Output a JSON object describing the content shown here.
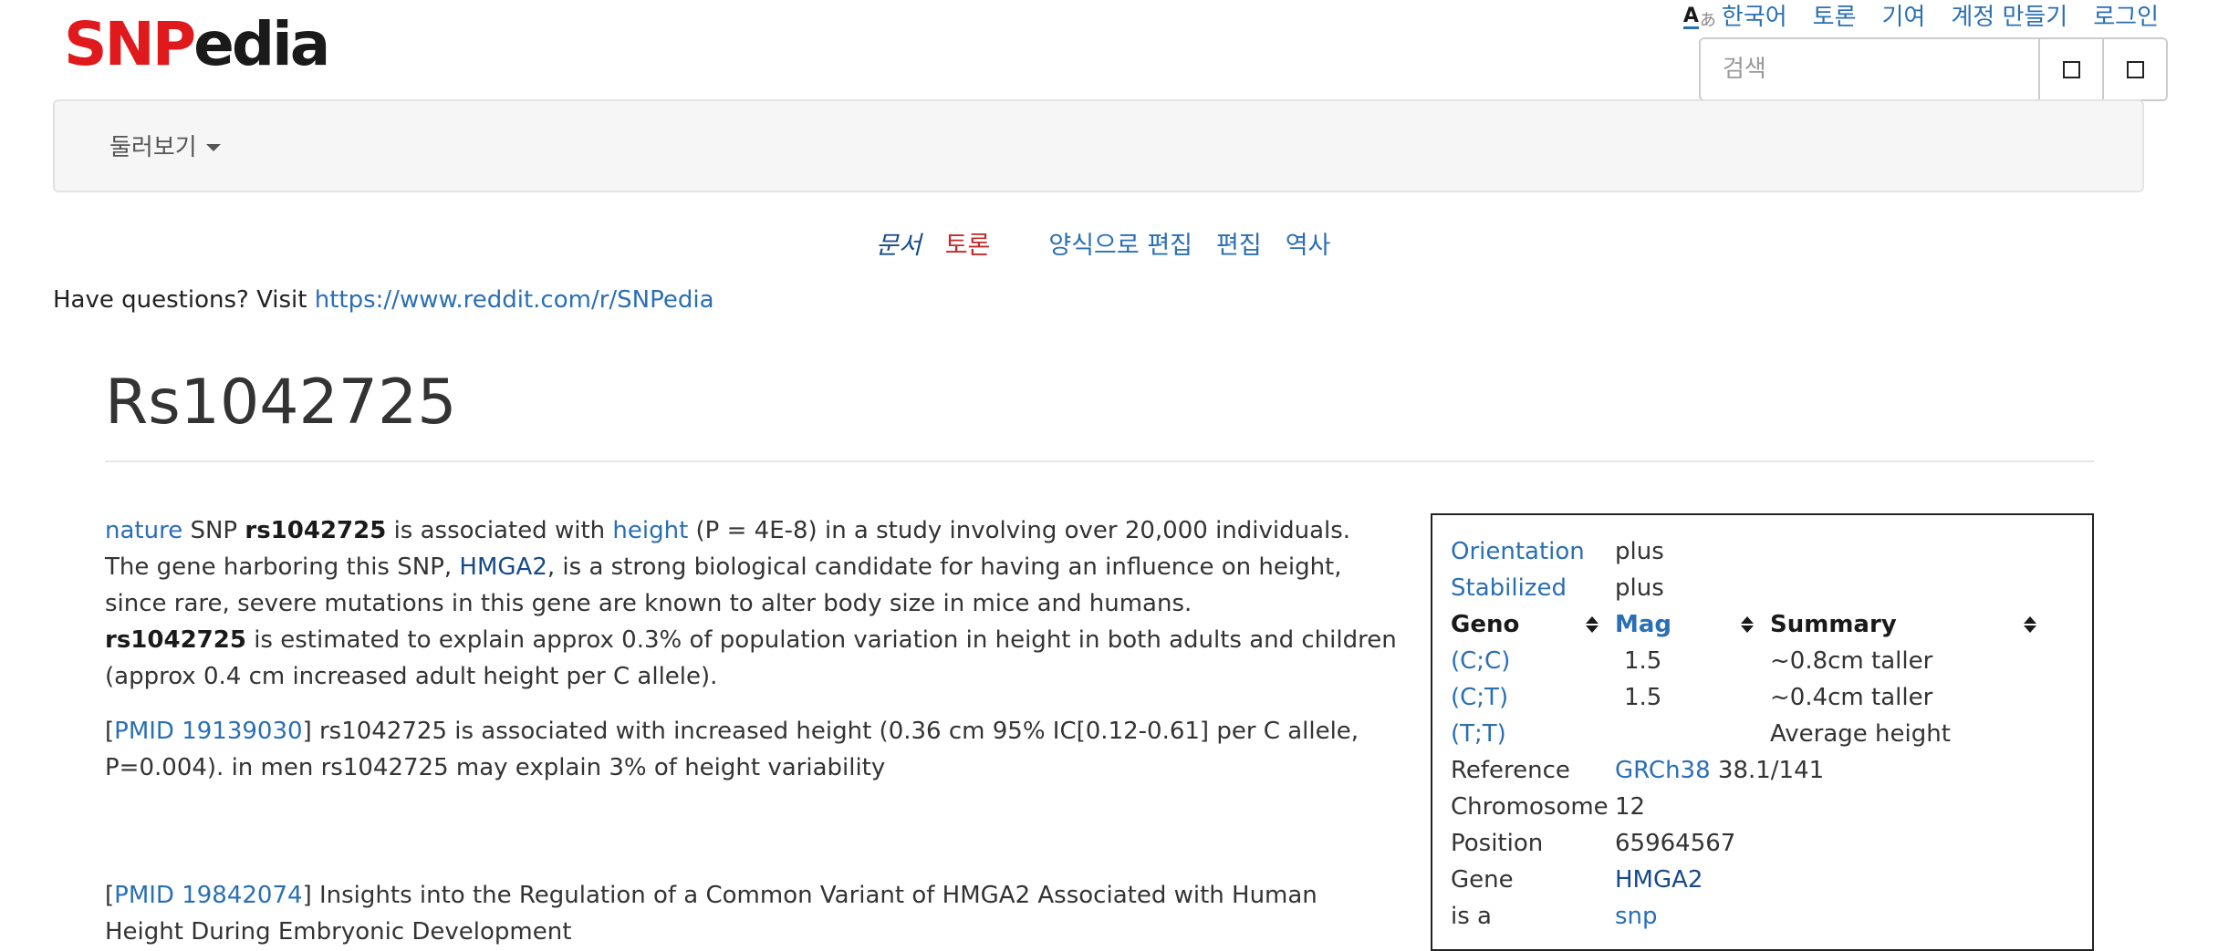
{
  "logo": {
    "part1": "SNP",
    "part2": "edia"
  },
  "personal_nav": {
    "language_icon": "translate-icon",
    "language": "한국어",
    "talk": "토론",
    "contributions": "기여",
    "create_account": "계정 만들기",
    "login": "로그인"
  },
  "search": {
    "placeholder": "검색",
    "go_icon": "square-icon",
    "fulltext_icon": "square-icon"
  },
  "navbar": {
    "dropdown_label": "둘러보기"
  },
  "page_tabs": {
    "page": "문서",
    "talk": "토론",
    "form_edit": "양식으로 편집",
    "edit": "편집",
    "history": "역사"
  },
  "notice": {
    "text": "Have questions? Visit ",
    "link": "https://www.reddit.com/r/SNPedia"
  },
  "title": "Rs1042725",
  "content": {
    "p1": {
      "link_nature": "nature",
      "t1": " SNP ",
      "bold1": "rs1042725",
      "t2": " is associated with ",
      "link_height": "height",
      "t3": " (P = 4E-8) in a study involving over 20,000 individuals. The gene harboring this SNP, ",
      "link_hmga2": "HMGA2",
      "t4": ", is a strong biological candidate for having an influence on height, since rare, severe mutations in this gene are known to alter body size in mice and humans."
    },
    "p2": {
      "bold": "rs1042725",
      "text": " is estimated to explain approx 0.3% of population variation in height in both adults and children (approx 0.4 cm increased adult height per C allele)."
    },
    "p3": {
      "open": "[",
      "link": "PMID 19139030",
      "text": "] rs1042725 is associated with increased height (0.36 cm 95% IC[0.12-0.61] per C allele, P=0.004). in men rs1042725 may explain 3% of height variability"
    },
    "p4": {
      "open": "[",
      "link": "PMID 19842074",
      "text": "] Insights into the Regulation of a Common Variant of HMGA2 Associated with Human Height During Embryonic Development"
    }
  },
  "infobox": {
    "orientation_label": "Orientation",
    "orientation_value": "plus",
    "stabilized_label": "Stabilized",
    "stabilized_value": "plus",
    "headers": {
      "geno": "Geno",
      "mag": "Mag",
      "summary": "Summary"
    },
    "genotypes": [
      {
        "geno": "(C;C)",
        "mag": "1.5",
        "summary": "~0.8cm taller"
      },
      {
        "geno": "(C;T)",
        "mag": "1.5",
        "summary": "~0.4cm taller"
      },
      {
        "geno": "(T;T)",
        "mag": "",
        "summary": "Average height"
      }
    ],
    "reference_label": "Reference",
    "reference_link": "GRCh38",
    "reference_value": " 38.1/141",
    "chromosome_label": "Chromosome",
    "chromosome_value": "12",
    "position_label": "Position",
    "position_value": "65964567",
    "gene_label": "Gene",
    "gene_value": "HMGA2",
    "isa_label": "is a",
    "isa_value": "snp"
  }
}
